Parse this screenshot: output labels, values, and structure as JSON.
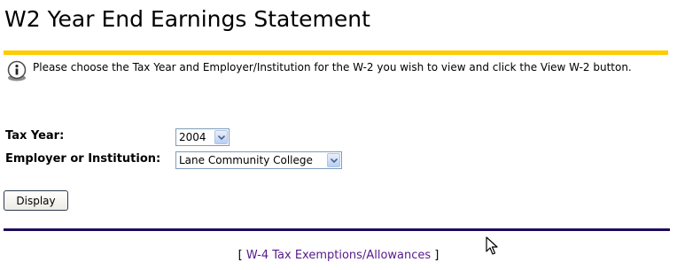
{
  "page": {
    "title": "W2 Year End Earnings Statement",
    "accent_color": "#ffcc00",
    "rule_color": "#1e0b5a"
  },
  "info": {
    "icon": "info-icon",
    "text": "Please choose the Tax Year and Employer/Institution for the W-2 you wish to view and click the View W-2 button."
  },
  "form": {
    "tax_year": {
      "label": "Tax Year:",
      "selected": "2004"
    },
    "employer": {
      "label": "Employer or Institution:",
      "selected": "Lane Community College"
    },
    "display_button_label": "Display"
  },
  "footer": {
    "open_bracket": "[",
    "link_label": "W-4 Tax Exemptions/Allowances",
    "close_bracket": "]",
    "link_color": "#551a8b"
  }
}
